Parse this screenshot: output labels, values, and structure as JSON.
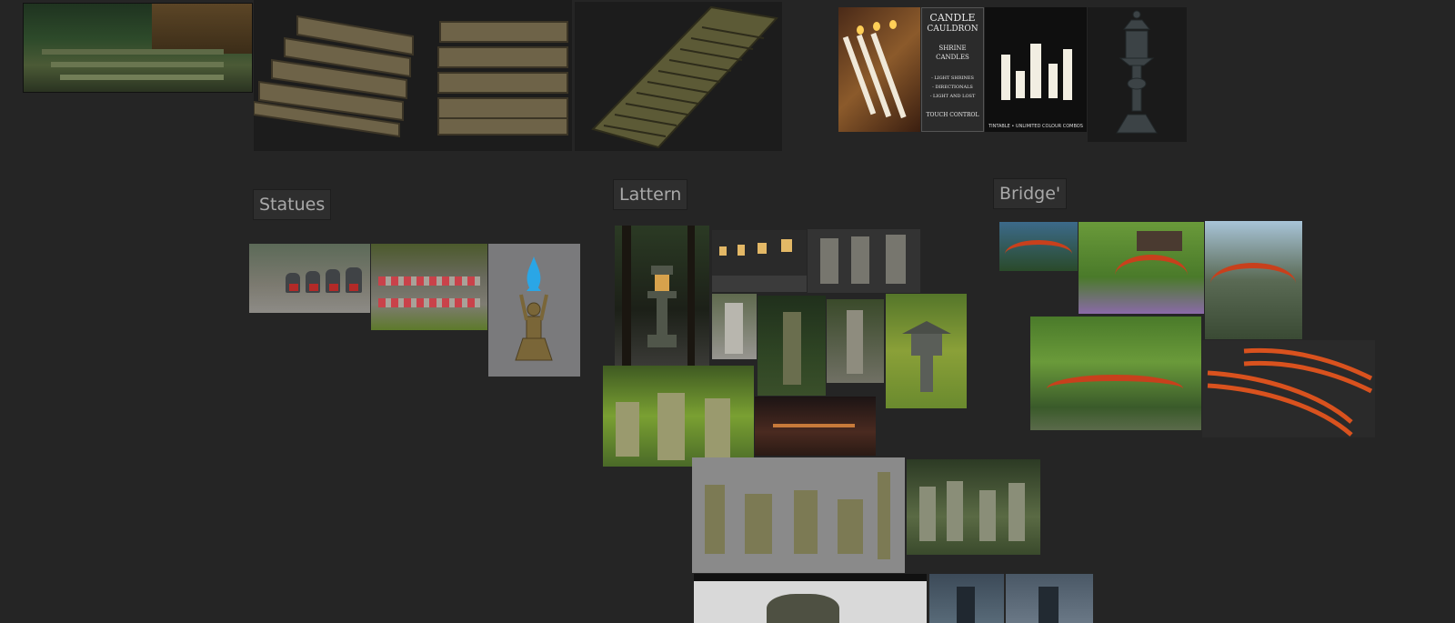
{
  "labels": {
    "statues": "Statues",
    "lantern": "Lattern",
    "bridge": "Bridge'"
  },
  "images": {
    "candles_sign": {
      "line1": "CANDLE",
      "line2": "CAULDRON",
      "line3": "SHRINE",
      "line4": "CANDLES",
      "line5": "- LIGHT SHRINES",
      "line6": "- DIRECTIONALS",
      "line7": "- LIGHT AND LOST",
      "line8": "TOUCH CONTROL"
    },
    "candles_photo_caption": "TINTABLE • UNLIMITED COLOUR COMBOS"
  },
  "colors": {
    "background": "#252525",
    "label_bg": "#2e2e2e",
    "label_text": "#a9a9a9",
    "bridge_red": "#c8401c"
  }
}
